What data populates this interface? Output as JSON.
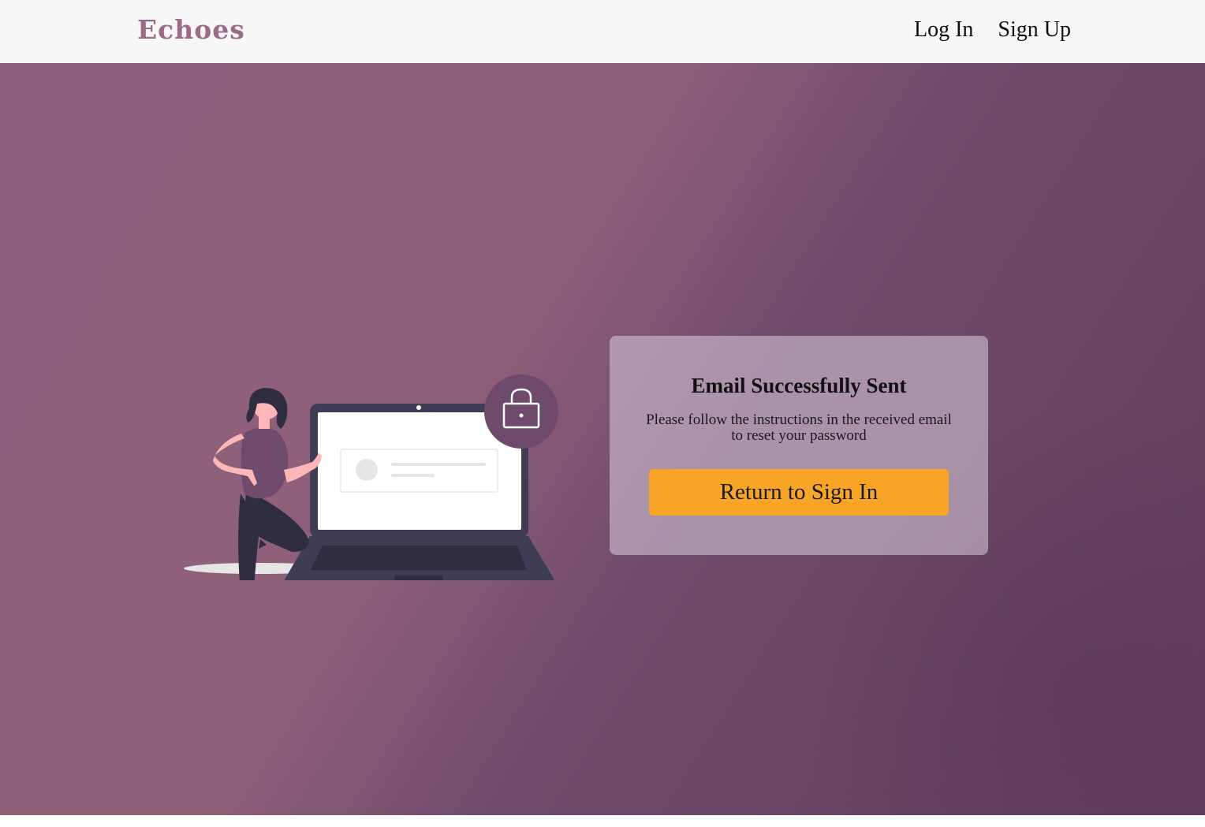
{
  "navbar": {
    "brand": "Echoes",
    "links": [
      {
        "label": "Log In"
      },
      {
        "label": "Sign Up"
      }
    ]
  },
  "card": {
    "title": "Email Successfully Sent",
    "message": "Please follow the instructions in the received email to reset your password",
    "button_label": "Return to Sign In"
  },
  "illustration": {
    "icon": "lock-icon"
  },
  "colors": {
    "brand": "#9c6b88",
    "accent": "#f8a426",
    "navbar_bg": "#f7f7f7",
    "hero_bg_dark": "#5f3c5d",
    "hero_bg_light": "#8d5f7b"
  }
}
